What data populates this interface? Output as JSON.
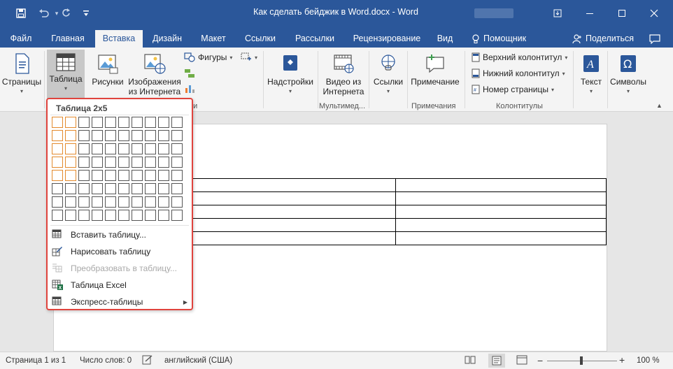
{
  "title_bar": {
    "doc_title": "Как сделать бейджик в Word.docx  -  Word",
    "save_icon": "save-icon",
    "undo_icon": "undo-icon",
    "redo_icon": "redo-icon",
    "customize_icon": "customize-qat-icon"
  },
  "tabs": {
    "file": "Файл",
    "home": "Главная",
    "insert": "Вставка",
    "design": "Дизайн",
    "layout": "Макет",
    "references": "Ссылки",
    "mailings": "Рассылки",
    "review": "Рецензирование",
    "view": "Вид",
    "tell_me": "Помощник",
    "share": "Поделиться"
  },
  "ribbon": {
    "pages": "Страницы",
    "table": "Таблица",
    "pictures": "Рисунки",
    "online_pictures_1": "Изображения",
    "online_pictures_2": "из Интернета",
    "shapes": "Фигуры",
    "illustrations_group_tail": "ии",
    "addins": "Надстройки",
    "online_video_1": "Видео из",
    "online_video_2": "Интернета",
    "media_group": "Мультимед...",
    "links": "Ссылки",
    "comment": "Примечание",
    "comments_group": "Примечания",
    "header": "Верхний колонтитул",
    "footer": "Нижний колонтитул",
    "page_number": "Номер страницы",
    "header_footer_group": "Колонтитулы",
    "text": "Текст",
    "symbols": "Символы"
  },
  "table_menu": {
    "title": "Таблица 2x5",
    "grid_cols": 10,
    "grid_rows": 8,
    "selected_cols": 2,
    "selected_rows": 5,
    "items": {
      "insert_table": "Вставить таблицу...",
      "draw_table": "Нарисовать таблицу",
      "convert_to_table": "Преобразовать в таблицу...",
      "excel_table": "Таблица Excel",
      "quick_tables": "Экспресс-таблицы"
    }
  },
  "document": {
    "table_rows": 5,
    "table_cols": 2
  },
  "status_bar": {
    "page": "Страница 1 из 1",
    "words": "Число слов: 0",
    "language": "английский (США)",
    "zoom": "100 %",
    "zoom_minus": "−",
    "zoom_plus": "+"
  },
  "colors": {
    "brand": "#2b579a",
    "highlight": "#e38a2d",
    "menu_border": "#e0433d"
  }
}
